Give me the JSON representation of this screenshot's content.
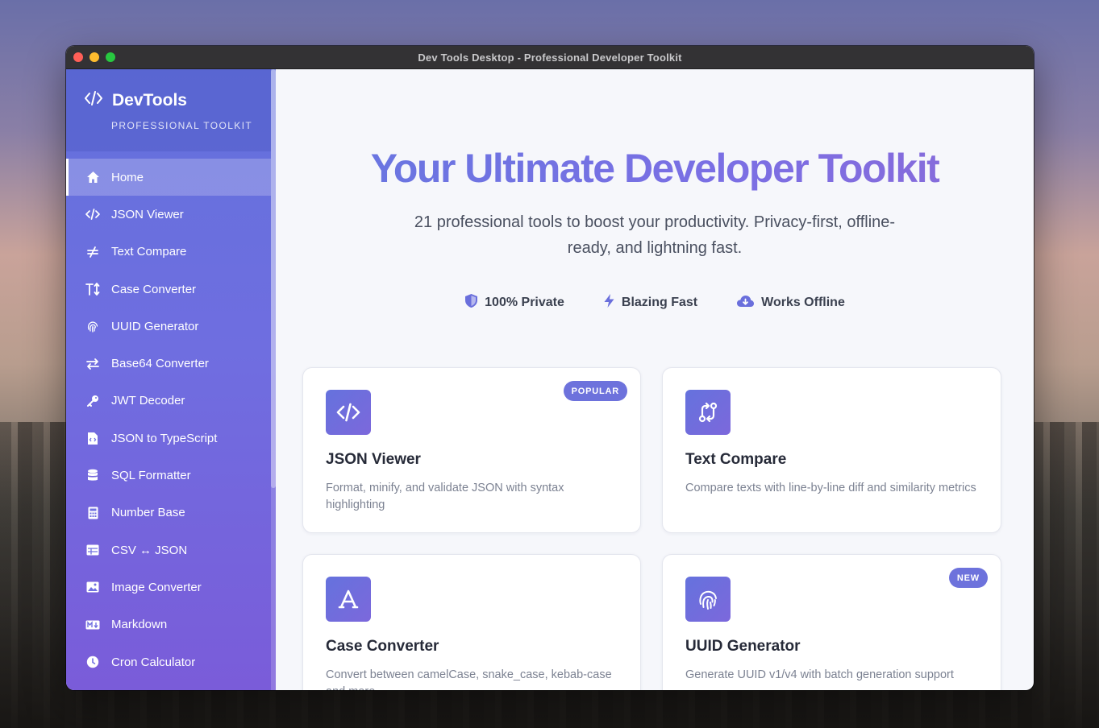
{
  "window": {
    "title": "Dev Tools Desktop - Professional Developer Toolkit"
  },
  "sidebar": {
    "brand_name": "DevTools",
    "brand_sub": "PROFESSIONAL TOOLKIT",
    "items": [
      {
        "label": "Home",
        "icon": "home-icon"
      },
      {
        "label": "JSON Viewer",
        "icon": "code-icon"
      },
      {
        "label": "Text Compare",
        "icon": "not-equal-icon"
      },
      {
        "label": "Case Converter",
        "icon": "text-height-icon"
      },
      {
        "label": "UUID Generator",
        "icon": "fingerprint-icon"
      },
      {
        "label": "Base64 Converter",
        "icon": "exchange-icon"
      },
      {
        "label": "JWT Decoder",
        "icon": "key-icon"
      },
      {
        "label": "JSON to TypeScript",
        "icon": "file-code-icon"
      },
      {
        "label": "SQL Formatter",
        "icon": "database-icon"
      },
      {
        "label": "Number Base",
        "icon": "calculator-icon"
      },
      {
        "label": "CSV ↔ JSON",
        "icon": "table-icon"
      },
      {
        "label": "Image Converter",
        "icon": "image-icon"
      },
      {
        "label": "Markdown",
        "icon": "markdown-icon"
      },
      {
        "label": "Cron Calculator",
        "icon": "clock-icon"
      }
    ]
  },
  "hero": {
    "title": "Your Ultimate Developer Toolkit",
    "subtitle": "21 professional tools to boost your productivity. Privacy-first, offline-ready, and lightning fast.",
    "badges": [
      {
        "label": "100% Private",
        "icon": "shield-icon"
      },
      {
        "label": "Blazing Fast",
        "icon": "bolt-icon"
      },
      {
        "label": "Works Offline",
        "icon": "cloud-download-icon"
      }
    ]
  },
  "cards": [
    {
      "title": "JSON Viewer",
      "desc": "Format, minify, and validate JSON with syntax highlighting",
      "tag": "POPULAR",
      "icon": "code-icon"
    },
    {
      "title": "Text Compare",
      "desc": "Compare texts with line-by-line diff and similarity metrics",
      "tag": "",
      "icon": "git-compare-icon"
    },
    {
      "title": "Case Converter",
      "desc": "Convert between camelCase, snake_case, kebab-case and more",
      "tag": "",
      "icon": "font-icon"
    },
    {
      "title": "UUID Generator",
      "desc": "Generate UUID v1/v4 with batch generation support",
      "tag": "NEW",
      "icon": "fingerprint-icon"
    }
  ],
  "colors": {
    "accent": "#6d72dc",
    "sidebar_top": "#6371dc",
    "sidebar_bottom": "#7a5cd9"
  }
}
